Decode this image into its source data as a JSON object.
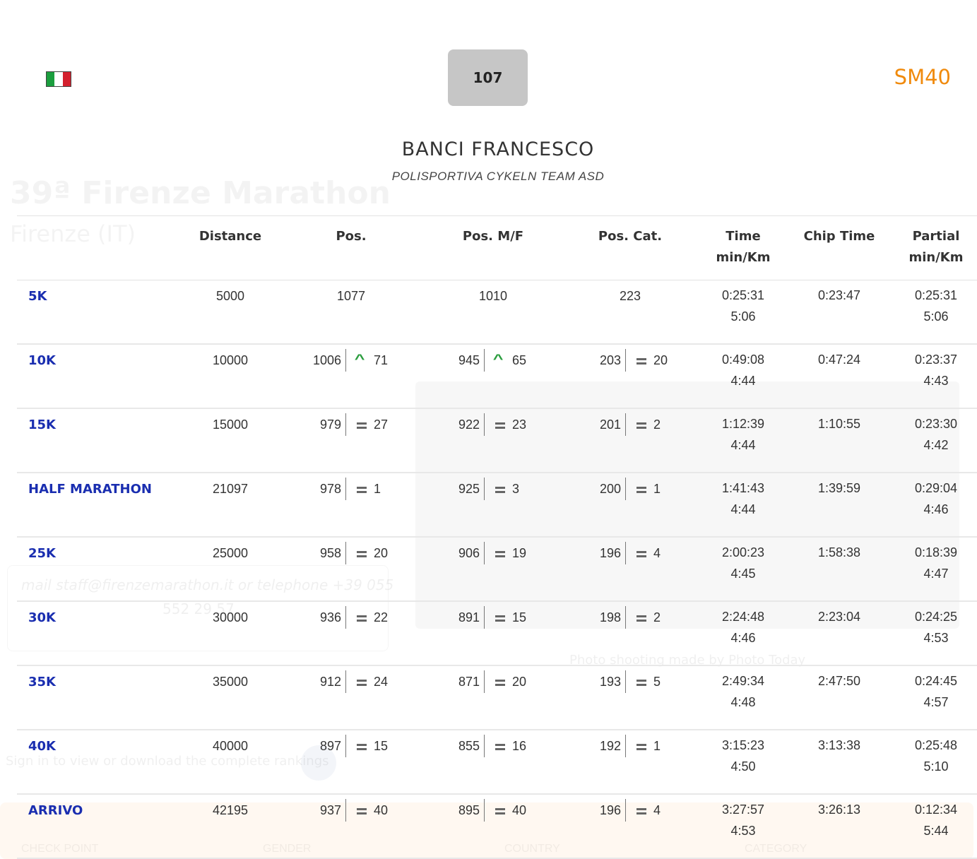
{
  "athlete": {
    "bib": "107",
    "category": "SM40",
    "name": "BANCI FRANCESCO",
    "team": "POLISPORTIVA CYKELN TEAM ASD",
    "flag_icon": "italy-flag-icon"
  },
  "colors": {
    "category": "#f08a0c",
    "checkpoint_link": "#1a2eb0",
    "up_indicator": "#2a9d3e",
    "bib_bg": "#c6c6c6"
  },
  "columns": {
    "distance": "Distance",
    "pos": "Pos.",
    "pos_mf": "Pos. M/F",
    "pos_cat": "Pos. Cat.",
    "time_l1": "Time",
    "time_l2": "min/Km",
    "chip": "Chip Time",
    "partial_l1": "Partial",
    "partial_l2": "min/Km"
  },
  "rows": [
    {
      "checkpoint": "5K",
      "distance": "5000",
      "pos": "1077",
      "pos_delta": "",
      "pos_trend": "",
      "mf": "1010",
      "mf_delta": "",
      "mf_trend": "",
      "cat": "223",
      "cat_delta": "",
      "cat_trend": "",
      "time": "0:25:31",
      "time_pace": "5:06",
      "chip": "0:23:47",
      "partial": "0:25:31",
      "partial_pace": "5:06"
    },
    {
      "checkpoint": "10K",
      "distance": "10000",
      "pos": "1006",
      "pos_delta": "71",
      "pos_trend": "up",
      "mf": "945",
      "mf_delta": "65",
      "mf_trend": "up",
      "cat": "203",
      "cat_delta": "20",
      "cat_trend": "equal",
      "time": "0:49:08",
      "time_pace": "4:44",
      "chip": "0:47:24",
      "partial": "0:23:37",
      "partial_pace": "4:43"
    },
    {
      "checkpoint": "15K",
      "distance": "15000",
      "pos": "979",
      "pos_delta": "27",
      "pos_trend": "equal",
      "mf": "922",
      "mf_delta": "23",
      "mf_trend": "equal",
      "cat": "201",
      "cat_delta": "2",
      "cat_trend": "equal",
      "time": "1:12:39",
      "time_pace": "4:44",
      "chip": "1:10:55",
      "partial": "0:23:30",
      "partial_pace": "4:42"
    },
    {
      "checkpoint": "HALF MARATHON",
      "distance": "21097",
      "pos": "978",
      "pos_delta": "1",
      "pos_trend": "equal",
      "mf": "925",
      "mf_delta": "3",
      "mf_trend": "equal",
      "cat": "200",
      "cat_delta": "1",
      "cat_trend": "equal",
      "time": "1:41:43",
      "time_pace": "4:44",
      "chip": "1:39:59",
      "partial": "0:29:04",
      "partial_pace": "4:46"
    },
    {
      "checkpoint": "25K",
      "distance": "25000",
      "pos": "958",
      "pos_delta": "20",
      "pos_trend": "equal",
      "mf": "906",
      "mf_delta": "19",
      "mf_trend": "equal",
      "cat": "196",
      "cat_delta": "4",
      "cat_trend": "equal",
      "time": "2:00:23",
      "time_pace": "4:45",
      "chip": "1:58:38",
      "partial": "0:18:39",
      "partial_pace": "4:47"
    },
    {
      "checkpoint": "30K",
      "distance": "30000",
      "pos": "936",
      "pos_delta": "22",
      "pos_trend": "equal",
      "mf": "891",
      "mf_delta": "15",
      "mf_trend": "equal",
      "cat": "198",
      "cat_delta": "2",
      "cat_trend": "equal",
      "time": "2:24:48",
      "time_pace": "4:46",
      "chip": "2:23:04",
      "partial": "0:24:25",
      "partial_pace": "4:53"
    },
    {
      "checkpoint": "35K",
      "distance": "35000",
      "pos": "912",
      "pos_delta": "24",
      "pos_trend": "equal",
      "mf": "871",
      "mf_delta": "20",
      "mf_trend": "equal",
      "cat": "193",
      "cat_delta": "5",
      "cat_trend": "equal",
      "time": "2:49:34",
      "time_pace": "4:48",
      "chip": "2:47:50",
      "partial": "0:24:45",
      "partial_pace": "4:57"
    },
    {
      "checkpoint": "40K",
      "distance": "40000",
      "pos": "897",
      "pos_delta": "15",
      "pos_trend": "equal",
      "mf": "855",
      "mf_delta": "16",
      "mf_trend": "equal",
      "cat": "192",
      "cat_delta": "1",
      "cat_trend": "equal",
      "time": "3:15:23",
      "time_pace": "4:50",
      "chip": "3:13:38",
      "partial": "0:25:48",
      "partial_pace": "5:10"
    },
    {
      "checkpoint": "ARRIVO",
      "distance": "42195",
      "pos": "937",
      "pos_delta": "40",
      "pos_trend": "equal",
      "mf": "895",
      "mf_delta": "40",
      "mf_trend": "equal",
      "cat": "196",
      "cat_delta": "4",
      "cat_trend": "equal",
      "time": "3:27:57",
      "time_pace": "4:53",
      "chip": "3:26:13",
      "partial": "0:12:34",
      "partial_pace": "5:44"
    }
  ],
  "background": {
    "title": "39ª Firenze Marathon",
    "subtitle": "Firenze (IT)",
    "mail_line": "mail staff@firenzemarathon.it or telephone +39 055",
    "phone_line": "552 29 57",
    "photo_credit": "Photo shooting made by Photo Today",
    "signin": "Sign in to view or download the complete rankings",
    "footer_cols": [
      "CHECK POINT",
      "GENDER",
      "COUNTRY",
      "CATEGORY"
    ]
  }
}
